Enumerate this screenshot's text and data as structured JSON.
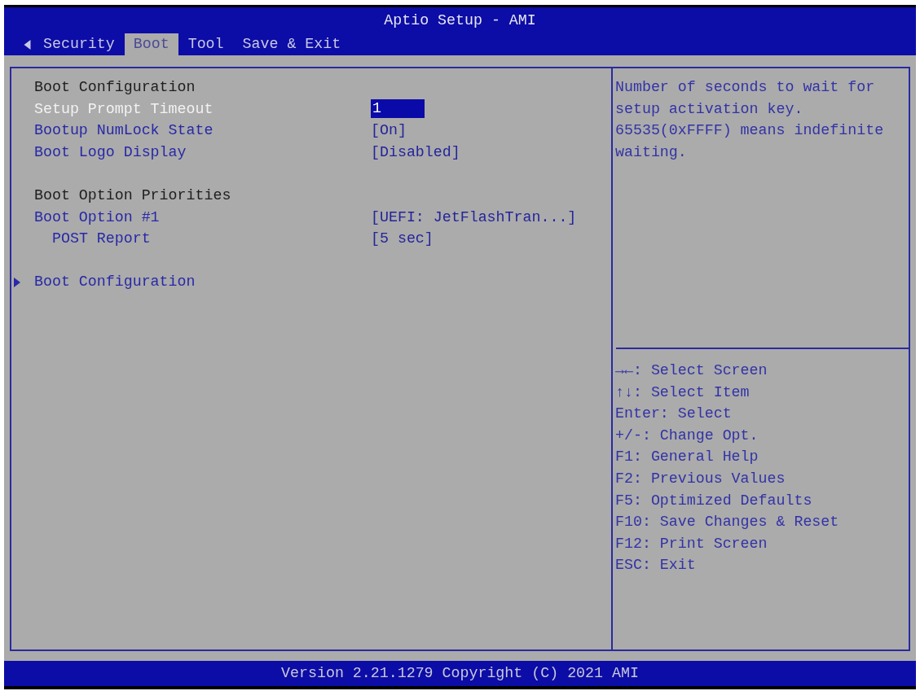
{
  "window": {
    "title": "Aptio Setup - AMI"
  },
  "tabs": [
    {
      "label": "Security",
      "selected": false
    },
    {
      "label": "Boot",
      "selected": true
    },
    {
      "label": "Tool",
      "selected": false
    },
    {
      "label": "Save & Exit",
      "selected": false
    }
  ],
  "sections": [
    {
      "title": "Boot Configuration",
      "items": [
        {
          "label": "Setup Prompt Timeout",
          "kind": "number",
          "value": "1",
          "selected": true
        },
        {
          "label": "Bootup NumLock State",
          "kind": "option",
          "value": "[On]",
          "selected": false
        },
        {
          "label": "Boot Logo Display",
          "kind": "option",
          "value": "[Disabled]",
          "selected": false
        }
      ]
    },
    {
      "title": "Boot Option Priorities",
      "items": [
        {
          "label": "Boot Option #1",
          "kind": "option",
          "value": "[UEFI: JetFlashTran...]",
          "selected": false,
          "children": [
            {
              "label": "POST Report",
              "kind": "option",
              "value": "[5 sec]",
              "selected": false
            }
          ]
        }
      ]
    }
  ],
  "submenus": [
    {
      "label": "Boot Configuration",
      "selected": false
    }
  ],
  "help": {
    "text": "Number of seconds to wait for setup activation key. 65535(0xFFFF) means indefinite waiting.",
    "keys": [
      "→←: Select Screen",
      "↑↓: Select Item",
      "Enter: Select",
      "+/-: Change Opt.",
      "F1: General Help",
      "F2: Previous Values",
      "F5: Optimized Defaults",
      "F10: Save Changes & Reset",
      "F12: Print Screen",
      "ESC: Exit"
    ]
  },
  "status_bar": {
    "text": "Version 2.21.1279 Copyright (C) 2021 AMI"
  }
}
